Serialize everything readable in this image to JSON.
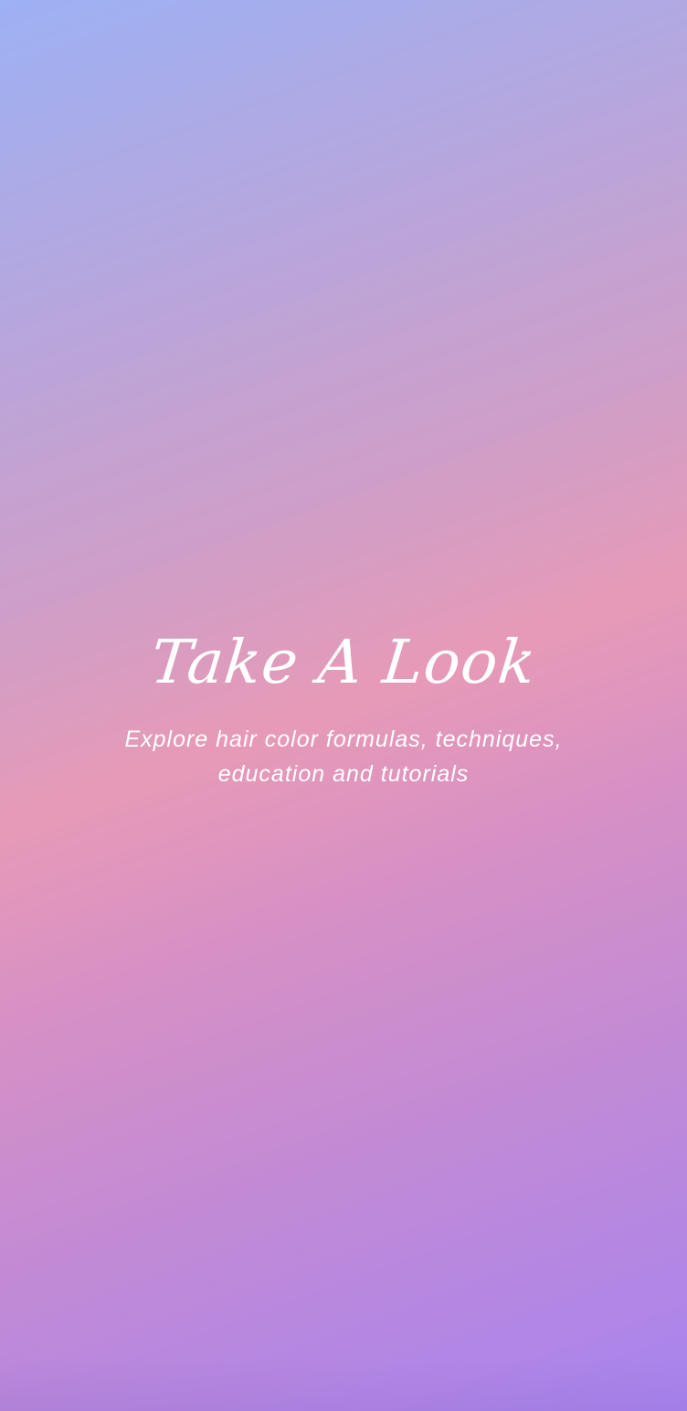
{
  "welcome": {
    "title": "Take A Look",
    "subtitle": "Explore hair color formulas, techniques, education and tutorials"
  },
  "colors": {
    "gradient_top_left": "#9db1f4",
    "gradient_middle": "#e79ab7",
    "gradient_bottom_right": "#a884ef",
    "text": "#ffffff"
  }
}
